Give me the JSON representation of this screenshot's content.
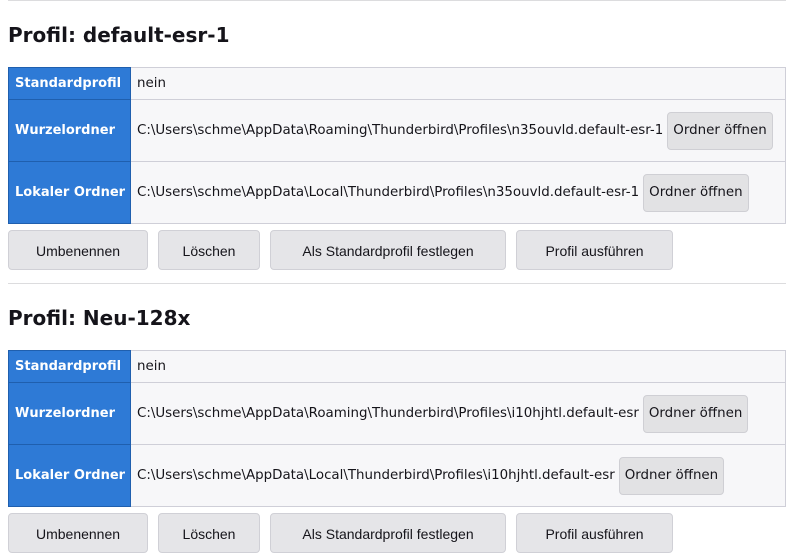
{
  "profiles": [
    {
      "title": "Profil: default-esr-1",
      "default_label": "Standardprofil",
      "default_value": "nein",
      "root_label": "Wurzelordner",
      "root_path": "C:\\Users\\schme\\AppData\\Roaming\\Thunderbird\\Profiles\\n35ouvld.default-esr-1",
      "local_label": "Lokaler Ordner",
      "local_path": "C:\\Users\\schme\\AppData\\Local\\Thunderbird\\Profiles\\n35ouvld.default-esr-1",
      "open_folder_label": "Ordner öffnen",
      "buttons": {
        "rename": "Umbenennen",
        "delete": "Löschen",
        "set_default": "Als Standardprofil festlegen",
        "run": "Profil ausführen"
      }
    },
    {
      "title": "Profil: Neu-128x",
      "default_label": "Standardprofil",
      "default_value": "nein",
      "root_label": "Wurzelordner",
      "root_path": "C:\\Users\\schme\\AppData\\Roaming\\Thunderbird\\Profiles\\i10hjhtl.default-esr",
      "local_label": "Lokaler Ordner",
      "local_path": "C:\\Users\\schme\\AppData\\Local\\Thunderbird\\Profiles\\i10hjhtl.default-esr",
      "open_folder_label": "Ordner öffnen",
      "buttons": {
        "rename": "Umbenennen",
        "delete": "Löschen",
        "set_default": "Als Standardprofil festlegen",
        "run": "Profil ausführen"
      }
    }
  ]
}
